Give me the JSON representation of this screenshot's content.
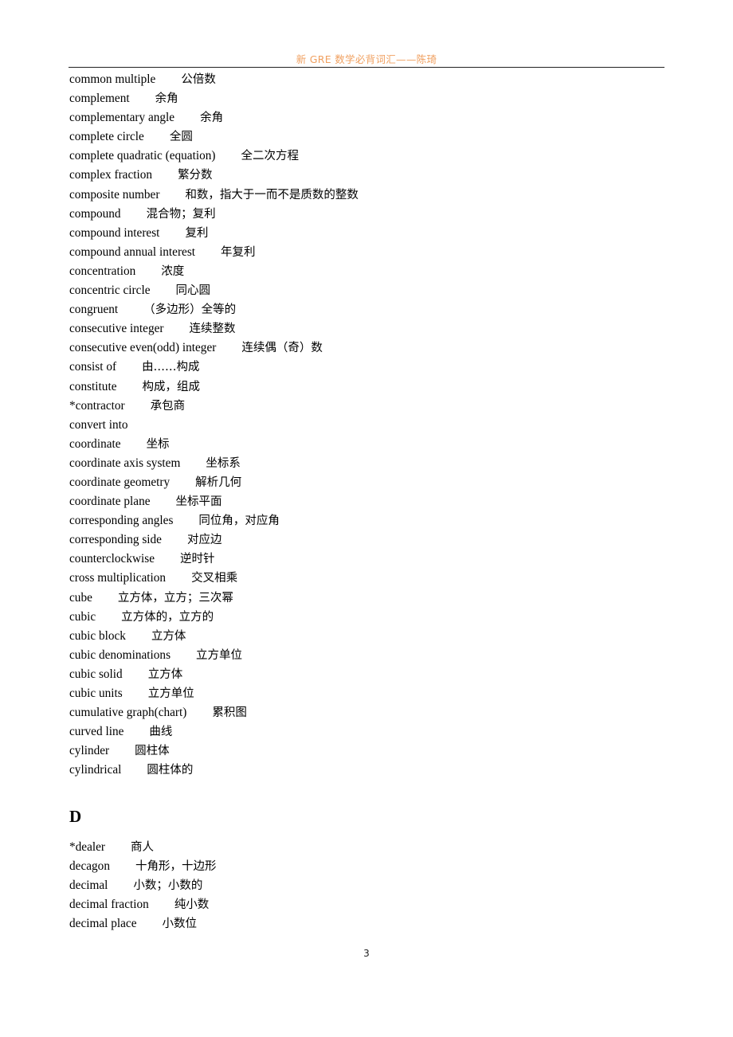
{
  "header": {
    "title": "新 GRE 数学必背词汇——陈琦"
  },
  "entries_c": [
    {
      "term": "common multiple",
      "def": "公倍数"
    },
    {
      "term": "complement",
      "def": "余角"
    },
    {
      "term": "complementary angle",
      "def": "余角"
    },
    {
      "term": "complete circle",
      "def": "全圆"
    },
    {
      "term": "complete quadratic (equation)",
      "def": "全二次方程"
    },
    {
      "term": "complex fraction",
      "def": "繁分数"
    },
    {
      "term": "composite number",
      "def": "和数，指大于一而不是质数的整数"
    },
    {
      "term": "compound",
      "def": "混合物；复利"
    },
    {
      "term": "compound interest",
      "def": "复利"
    },
    {
      "term": "compound annual interest",
      "def": "年复利"
    },
    {
      "term": "concentration",
      "def": "浓度"
    },
    {
      "term": "concentric circle",
      "def": "同心圆"
    },
    {
      "term": "congruent",
      "def": "（多边形）全等的"
    },
    {
      "term": "consecutive integer",
      "def": "连续整数"
    },
    {
      "term": "consecutive even(odd) integer",
      "def": "连续偶（奇）数"
    },
    {
      "term": "consist of",
      "def": "由……构成"
    },
    {
      "term": "constitute",
      "def": "构成，组成"
    },
    {
      "term": "*contractor",
      "def": "承包商"
    },
    {
      "term": "convert into",
      "def": ""
    },
    {
      "term": "coordinate",
      "def": "坐标"
    },
    {
      "term": "coordinate axis system",
      "def": "坐标系"
    },
    {
      "term": "coordinate geometry",
      "def": "解析几何"
    },
    {
      "term": "coordinate plane",
      "def": "坐标平面"
    },
    {
      "term": "corresponding angles",
      "def": "同位角，对应角"
    },
    {
      "term": "corresponding side",
      "def": "对应边"
    },
    {
      "term": "counterclockwise",
      "def": "逆时针"
    },
    {
      "term": "cross multiplication",
      "def": "交叉相乘"
    },
    {
      "term": "cube",
      "def": "立方体，立方；三次幂"
    },
    {
      "term": "cubic",
      "def": "立方体的，立方的"
    },
    {
      "term": "cubic block",
      "def": "立方体"
    },
    {
      "term": "cubic denominations",
      "def": "立方单位"
    },
    {
      "term": "cubic solid",
      "def": "立方体"
    },
    {
      "term": "cubic units",
      "def": "立方单位"
    },
    {
      "term": "cumulative graph(chart)",
      "def": "累积图"
    },
    {
      "term": "curved line",
      "def": "曲线"
    },
    {
      "term": "cylinder",
      "def": "圆柱体"
    },
    {
      "term": "cylindrical",
      "def": "圆柱体的"
    }
  ],
  "section_d": {
    "letter": "D",
    "entries": [
      {
        "term": "*dealer",
        "def": "商人"
      },
      {
        "term": "decagon",
        "def": "十角形，十边形"
      },
      {
        "term": "decimal",
        "def": "小数；小数的"
      },
      {
        "term": "decimal fraction",
        "def": "纯小数"
      },
      {
        "term": "decimal place",
        "def": "小数位"
      }
    ]
  },
  "footer": {
    "page_number": "3"
  }
}
